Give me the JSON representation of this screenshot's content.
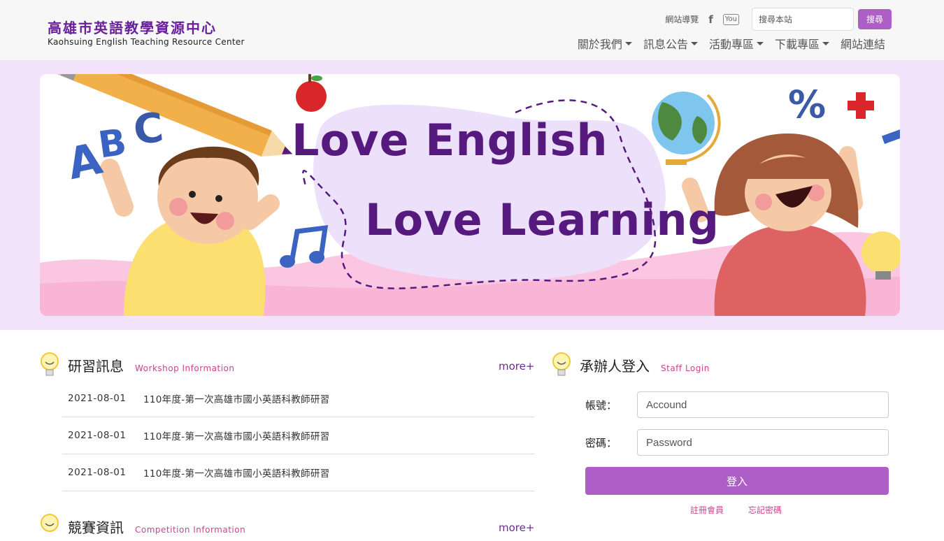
{
  "header": {
    "logo_zh": "高雄市英語教學資源中心",
    "logo_en": "Kaohsuing English Teaching Resource Center",
    "sitemap": "網站導覽",
    "facebook_icon": "f",
    "youtube_icon": "You",
    "search_placeholder": "搜尋本站",
    "search_button": "搜尋",
    "nav": [
      {
        "label": "關於我們",
        "dropdown": true
      },
      {
        "label": "訊息公告",
        "dropdown": true
      },
      {
        "label": "活動專區",
        "dropdown": true
      },
      {
        "label": "下載專區",
        "dropdown": true
      },
      {
        "label": "網站連結",
        "dropdown": false
      }
    ]
  },
  "banner": {
    "line1": "Love English",
    "line2": "Love Learning",
    "letters": [
      "A",
      "B",
      "C"
    ],
    "percent": "%"
  },
  "workshop": {
    "title": "研習訊息",
    "subtitle": "Workshop Information",
    "more": "more+",
    "items": [
      {
        "date": "2021-08-01",
        "title": "110年度-第一次高雄市國小英語科教師研習"
      },
      {
        "date": "2021-08-01",
        "title": "110年度-第一次高雄市國小英語科教師研習"
      },
      {
        "date": "2021-08-01",
        "title": "110年度-第一次高雄市國小英語科教師研習"
      }
    ]
  },
  "competition": {
    "title": "競賽資訊",
    "subtitle": "Competition Information",
    "more": "more+"
  },
  "login": {
    "title": "承辦人登入",
    "subtitle": "Staff Login",
    "account_label": "帳號：",
    "account_placeholder": "Accound",
    "password_label": "密碼：",
    "password_placeholder": "Password",
    "submit": "登入",
    "register": "註冊會員",
    "forgot": "忘記密碼"
  },
  "colors": {
    "brand": "#6a1f9a",
    "accent": "#ad5fc7",
    "pink": "#c9448e",
    "banner_band": "#f2e3fb"
  }
}
